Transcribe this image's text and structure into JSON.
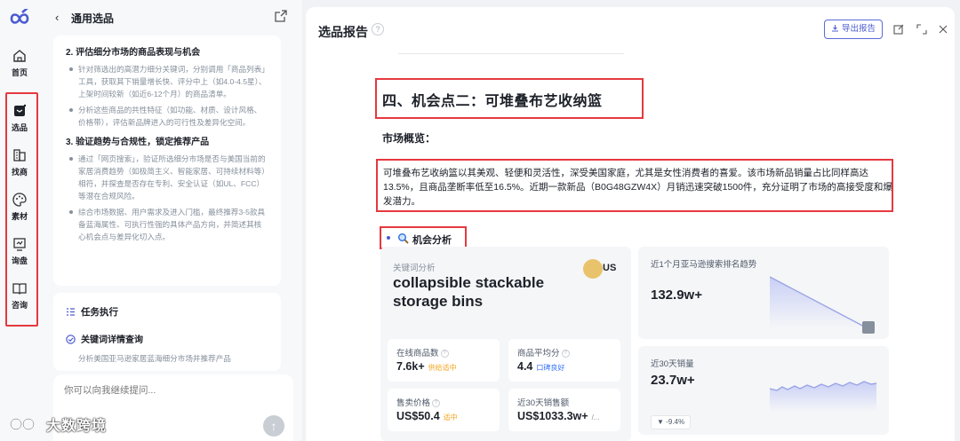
{
  "rail": {
    "items": [
      {
        "label": "首页",
        "icon": "home-icon"
      },
      {
        "label": "选品",
        "icon": "product-select-icon"
      },
      {
        "label": "找商",
        "icon": "find-supplier-icon"
      },
      {
        "label": "素材",
        "icon": "palette-icon"
      },
      {
        "label": "询盘",
        "icon": "inquiry-icon"
      },
      {
        "label": "咨询",
        "icon": "book-icon"
      }
    ]
  },
  "mid": {
    "title": "通用选品",
    "section2": {
      "heading": "2. 评估细分市场的商品表现与机会",
      "bullets": [
        "针对筛选出的高潜力细分关键词，分别调用「商品列表」工具，获取其下销量增长快、评分中上（如4.0-4.5星）、上架时间较新（如近6-12个月）的商品清单。",
        "分析这些商品的共性特征（如功能、材质、设计风格、价格带），评估新品牌进入的可行性及差异化空间。"
      ]
    },
    "section3": {
      "heading": "3. 验证趋势与合规性，锁定推荐产品",
      "bullets": [
        "通过「网页搜索」，验证所选细分市场是否与美国当前的家居消费趋势（如极简主义、智能家居、可持续材料等）相符，并探查是否存在专利、安全认证（如UL、FCC）等潜在合规风险。",
        "综合市场数据、用户需求及进入门槛，最终推荐3-5款具备蓝海属性、可执行性强的具体产品方向，并简述其核心机会点与差异化切入点。"
      ]
    },
    "task": {
      "heading": "任务执行",
      "item": "关键词详情查询",
      "sub": "分析美国亚马逊家居蓝海细分市场并推荐产品"
    },
    "input_placeholder": "你可以向我继续提问...",
    "watermark": "大数跨境"
  },
  "report": {
    "title": "选品报告",
    "export_label": "导出报告",
    "section_heading": "四、机会点二：可堆叠布艺收纳篮",
    "market_heading": "市场概览：",
    "market_text": "可堆叠布艺收纳篮以其美观、轻便和灵活性，深受美国家庭，尤其是女性消费者的喜爱。该市场新品销量占比同样高达13.5%，且商品垄断率低至16.5%。近期一款新品（B0G48GZW4X）月销迅速突破1500件，充分证明了市场的高接受度和爆发潜力。",
    "opportunity_label": "机会分析",
    "keyword_card": {
      "caption": "关键词分析",
      "term": "collapsible stackable storage bins",
      "country": "US",
      "stats": [
        {
          "label": "在线商品数",
          "value": "7.6k+",
          "tag": "供给适中",
          "tag_color": "#f5a623",
          "help": "?"
        },
        {
          "label": "商品平均分",
          "value": "4.4",
          "tag": "口碑良好",
          "tag_color": "#3370ff",
          "help": "?"
        },
        {
          "label": "售卖价格",
          "value": "US$50.4",
          "tag": "适中",
          "tag_color": "#f5a623",
          "help": "?"
        },
        {
          "label": "近30天销售额",
          "value": "US$1033.3w+",
          "tag": "/...",
          "tag_color": "#86909c",
          "help": ""
        }
      ]
    },
    "trend_rank": {
      "caption": "近1个月亚马逊搜索排名趋势",
      "value": "132.9w+"
    },
    "trend_sales": {
      "caption": "近30天销量",
      "value": "23.7w+",
      "change": "-9.4%"
    }
  },
  "colors": {
    "accent": "#4b5bd0",
    "highlight_box": "#e5393f",
    "trend_line": "#9aa4e6"
  }
}
